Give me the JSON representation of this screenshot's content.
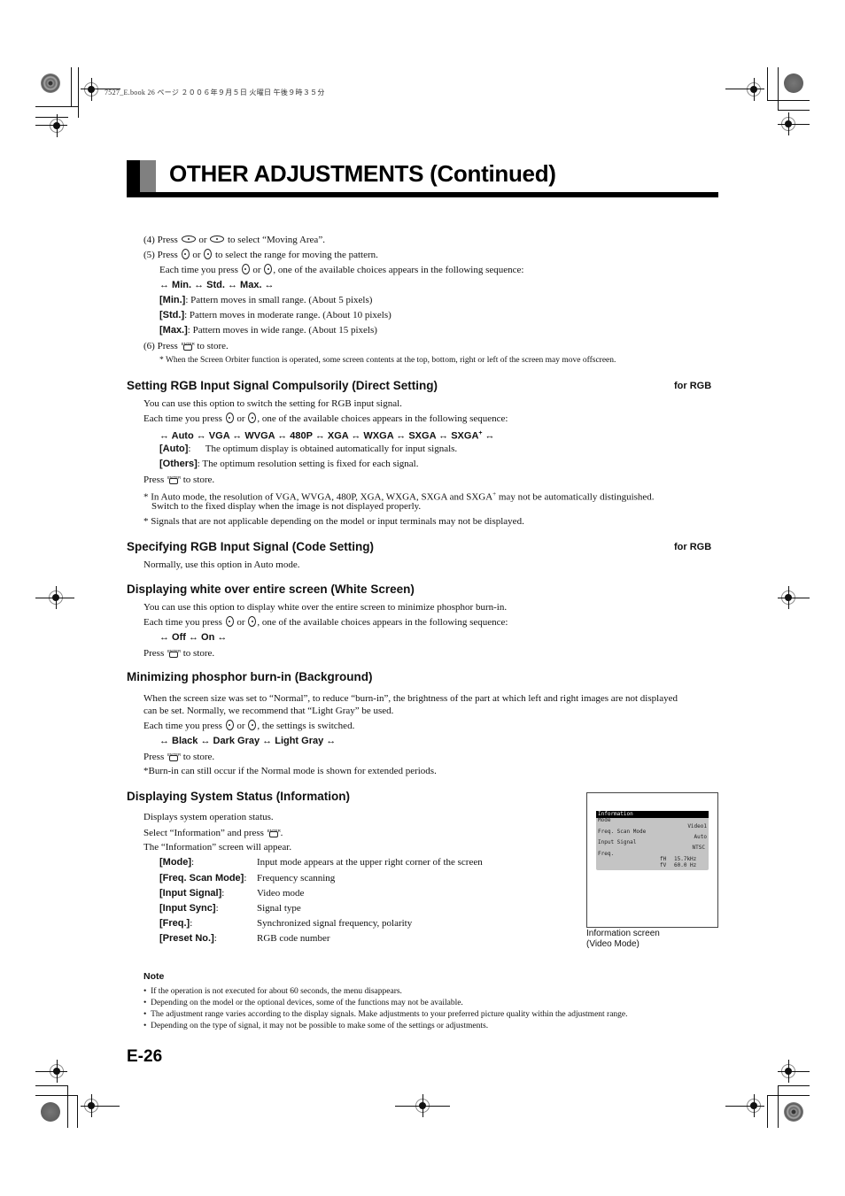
{
  "header_meta": "7527_E.book  26 ページ  ２００６年９月５日  火曜日  午後９時３５分",
  "page_title": "OTHER ADJUSTMENTS (Continued)",
  "moving_area": {
    "step4": [
      "(4) Press",
      "or",
      "to select “Moving Area”."
    ],
    "step5": [
      "(5) Press",
      "or",
      "to select the range for moving the pattern."
    ],
    "each_time": [
      "Each time you press",
      "or",
      ", one of the available choices appears in the following sequence:"
    ],
    "sequence": "↔ Min. ↔  Std. ↔ Max. ↔",
    "options": [
      {
        "key": "[Min.]",
        "desc": ":  Pattern moves in small range. (About 5 pixels)"
      },
      {
        "key": "[Std.]",
        "desc": ":   Pattern moves in moderate range. (About 10 pixels)"
      },
      {
        "key": "[Max.]",
        "desc": ":  Pattern moves in wide range. (About 15 pixels)"
      }
    ],
    "step6": [
      "(6) Press",
      "to store."
    ],
    "footnote": "* When the Screen Orbiter function is operated, some screen contents at the top, bottom, right or left of the screen may move offscreen."
  },
  "direct_setting": {
    "heading": "Setting RGB Input Signal Compulsorily (Direct Setting)",
    "tag": "for RGB",
    "intro": "You can use this option to switch the setting for RGB input signal.",
    "each_time": [
      "Each time you press",
      "or",
      ", one of the available choices appears in the following sequence:"
    ],
    "sequence": "↔ Auto ↔ VGA ↔ WVGA ↔ 480P ↔ XGA ↔ WXGA ↔ SXGA ↔ SXGA",
    "sequence_sup": "+",
    "sequence_end": " ↔",
    "options": [
      {
        "key": "[Auto]",
        "desc": ":      The optimum display is obtained automatically for input signals."
      },
      {
        "key": "[Others]",
        "desc": ":  The optimum resolution setting is fixed for each signal."
      }
    ],
    "store": [
      "Press",
      "to store."
    ],
    "note1a": "* In Auto mode, the resolution of VGA, WVGA, 480P, XGA, WXGA, SXGA and SXGA",
    "note1_sup": "+",
    "note1b": " may not be automatically distinguished.",
    "note1c": "Switch to the fixed display when the image is not displayed properly.",
    "note2": "* Signals that are not applicable depending on the model or input terminals may not be displayed."
  },
  "code_setting": {
    "heading": "Specifying RGB Input Signal (Code Setting)",
    "tag": "for RGB",
    "body": "Normally, use this option in Auto mode."
  },
  "white_screen": {
    "heading": "Displaying white over entire screen (White Screen)",
    "intro": "You can use this option to display white over the entire screen to minimize phosphor burn-in.",
    "each_time": [
      "Each time you press",
      "or",
      ", one of the available choices appears in the following sequence:"
    ],
    "sequence": "↔ Off ↔ On ↔",
    "store": [
      "Press",
      "to store."
    ]
  },
  "background": {
    "heading": "Minimizing phosphor burn-in (Background)",
    "intro1": "When the screen size was set to “Normal”, to reduce “burn-in”, the brightness of the part at which left and right images are not displayed",
    "intro2": "can be set. Normally, we recommend that “Light Gray” be used.",
    "each_time": [
      "Each time you press",
      "or",
      ", the settings is switched."
    ],
    "sequence": "↔ Black ↔ Dark Gray ↔ Light Gray ↔",
    "store": [
      "Press",
      "to store."
    ],
    "note": "*Burn-in can still occur if the Normal mode is shown for extended periods."
  },
  "information": {
    "heading": "Displaying System Status (Information)",
    "line1": "Displays system operation status.",
    "line2": [
      "Select “Information” and press",
      "."
    ],
    "line3": "The “Information” screen will appear.",
    "items": [
      {
        "key": "[Mode]",
        "sep": ":",
        "desc": "Input mode appears at the upper right corner of the screen"
      },
      {
        "key": "[Freq. Scan Mode]",
        "sep": ":",
        "desc": "Frequency scanning"
      },
      {
        "key": "[Input Signal]",
        "sep": ":",
        "desc": "Video mode"
      },
      {
        "key": "[Input Sync]",
        "sep": ":",
        "desc": "Signal type"
      },
      {
        "key": "[Freq.]",
        "sep": ":",
        "desc": "Synchronized signal frequency, polarity"
      },
      {
        "key": "[Preset No.]",
        "sep": ":",
        "desc": "RGB code number"
      }
    ]
  },
  "info_screen": {
    "title": "Information",
    "rows": [
      {
        "label": "Mode",
        "value": "Video1"
      },
      {
        "label": "Freq. Scan Mode",
        "value": "Auto"
      },
      {
        "label": "Input Signal",
        "value": "NTSC"
      },
      {
        "label": "Freq.",
        "value": ""
      }
    ],
    "fh_label": "fH",
    "fh_value": "15.7kHz",
    "fv_label": "fV",
    "fv_value": "60.0 Hz",
    "caption1": "Information screen",
    "caption2": "(Video Mode)"
  },
  "note": {
    "title": "Note",
    "bullets": [
      "If the operation is not executed for about 60 seconds, the menu disappears.",
      "Depending on the model or the optional devices, some of the functions may not be available.",
      "The adjustment range varies according to the display signals. Make adjustments to your preferred picture quality within the adjustment range.",
      "Depending on the type of signal, it may not be possible to make some of the settings or adjustments."
    ]
  },
  "page_number": "E-26",
  "icons": {
    "enter_label": "ENTER"
  }
}
